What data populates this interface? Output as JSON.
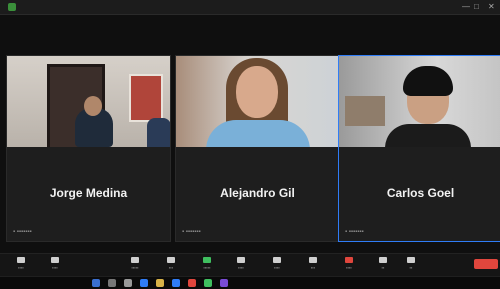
{
  "participants": [
    {
      "name": "Jorge Medina"
    },
    {
      "name": "Alejandro Gil"
    },
    {
      "name": "Carlos Goel"
    }
  ],
  "icons": {
    "window_controls": [
      "minimize-icon",
      "maximize-icon",
      "close-icon"
    ],
    "toolbar": [
      "mute-icon",
      "video-icon",
      "participants-icon",
      "chat-icon",
      "share-screen-icon",
      "record-icon",
      "reactions-icon",
      "apps-icon",
      "whiteboard-icon",
      "more-icon"
    ],
    "taskbar": [
      "start-icon",
      "search-icon",
      "taskview-icon",
      "browser-icon",
      "files-icon",
      "mail-icon",
      "app-icon"
    ]
  },
  "colors": {
    "background": "#0f0f0f",
    "tile": "#1c1c1c",
    "active_speaker_border": "#2f7cf6",
    "share_green": "#3fbf5f",
    "end_red": "#e0463d"
  }
}
